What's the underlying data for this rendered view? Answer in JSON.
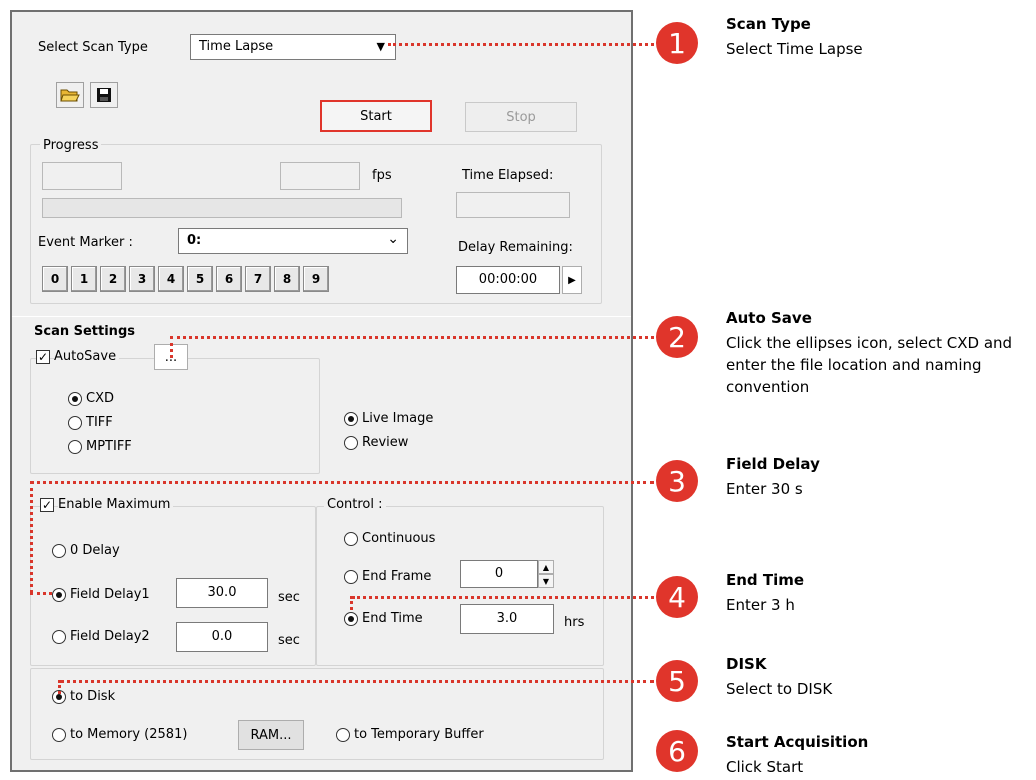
{
  "scan_type": {
    "label": "Select Scan Type",
    "value": "Time Lapse"
  },
  "toolbar": {
    "open_icon": "folder-open-icon",
    "save_icon": "floppy-disk-icon"
  },
  "buttons": {
    "start": "Start",
    "stop": "Stop"
  },
  "progress": {
    "group_label": "Progress",
    "fps_label": "fps",
    "time_elapsed_label": "Time Elapsed:",
    "event_marker_label": "Event Marker :",
    "event_marker_value": "0:",
    "delay_remaining_label": "Delay Remaining:",
    "delay_remaining_value": "00:00:00",
    "keys": [
      "0",
      "1",
      "2",
      "3",
      "4",
      "5",
      "6",
      "7",
      "8",
      "9"
    ]
  },
  "scan_settings": {
    "title": "Scan Settings",
    "autosave": {
      "label": "AutoSave",
      "checked": true,
      "ellipsis": "...",
      "formats": [
        "CXD",
        "TIFF",
        "MPTIFF"
      ],
      "selected": "CXD"
    },
    "view": {
      "options": [
        "Live Image",
        "Review"
      ],
      "selected": "Live Image"
    },
    "enable_maximum": {
      "label": "Enable Maximum",
      "checked": true
    },
    "delay": {
      "zero_delay": "0 Delay",
      "field_delay1": {
        "label": "Field Delay1",
        "value": "30.0",
        "unit": "sec"
      },
      "field_delay2": {
        "label": "Field Delay2",
        "value": "0.0",
        "unit": "sec"
      },
      "selected": "Field Delay1"
    },
    "control": {
      "label": "Control :",
      "continuous": "Continuous",
      "end_frame": {
        "label": "End Frame",
        "value": "0"
      },
      "end_time": {
        "label": "End Time",
        "value": "3.0",
        "unit": "hrs"
      },
      "selected": "End Time"
    },
    "destination": {
      "to_disk": "to Disk",
      "to_memory": "to Memory (2581)",
      "ram_button": "RAM...",
      "to_temp": "to Temporary Buffer",
      "selected": "to Disk"
    }
  },
  "callouts": [
    {
      "num": "1",
      "title": "Scan Type",
      "text": "Select Time Lapse"
    },
    {
      "num": "2",
      "title": "Auto Save",
      "text": "Click the ellipses icon, select CXD and enter the file location and naming convention"
    },
    {
      "num": "3",
      "title": "Field Delay",
      "text": "Enter 30 s"
    },
    {
      "num": "4",
      "title": "End Time",
      "text": "Enter 3 h"
    },
    {
      "num": "5",
      "title": "DISK",
      "text": "Select to DISK"
    },
    {
      "num": "6",
      "title": "Start Acquisition",
      "text": "Click Start"
    }
  ],
  "colors": {
    "accent": "#e0352b",
    "dialog_bg": "#f0f0f0"
  }
}
